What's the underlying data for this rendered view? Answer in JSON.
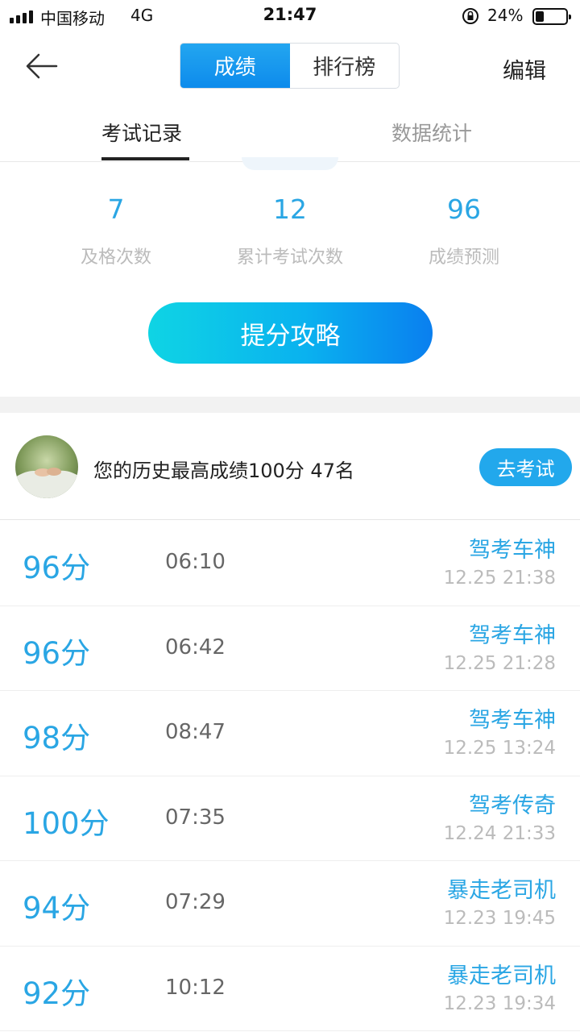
{
  "status_bar": {
    "carrier": "中国移动",
    "network": "4G",
    "time": "21:47",
    "battery": "24%",
    "battery_level": 0.24
  },
  "nav": {
    "back_icon": "back-arrow-icon",
    "segments": [
      "成绩",
      "排行榜"
    ],
    "active_segment": "成绩",
    "edit": "编辑"
  },
  "tabs": {
    "items": [
      "考试记录",
      "数据统计"
    ],
    "active": "考试记录"
  },
  "summary": {
    "stats": [
      {
        "value": "7",
        "label": "及格次数"
      },
      {
        "value": "12",
        "label": "累计考试次数"
      },
      {
        "value": "96",
        "label": "成绩预测"
      }
    ],
    "tips_button": "提分攻略"
  },
  "best": {
    "text": "您的历史最高成绩100分  47名",
    "button": "去考试"
  },
  "records": [
    {
      "score": "96分",
      "duration": "06:10",
      "title": "驾考车神",
      "time": "12.25 21:38"
    },
    {
      "score": "96分",
      "duration": "06:42",
      "title": "驾考车神",
      "time": "12.25 21:28"
    },
    {
      "score": "98分",
      "duration": "08:47",
      "title": "驾考车神",
      "time": "12.25 13:24"
    },
    {
      "score": "100分",
      "duration": "07:35",
      "title": "驾考传奇",
      "time": "12.24 21:33"
    },
    {
      "score": "94分",
      "duration": "07:29",
      "title": "暴走老司机",
      "time": "12.23 19:45"
    },
    {
      "score": "92分",
      "duration": "10:12",
      "title": "暴走老司机",
      "time": "12.23 19:34"
    }
  ],
  "colors": {
    "accent": "#2aa6e4",
    "segment_active": "#0d8bec",
    "button_gradient_start": "#0fd4e4",
    "button_gradient_end": "#0a7fef"
  }
}
